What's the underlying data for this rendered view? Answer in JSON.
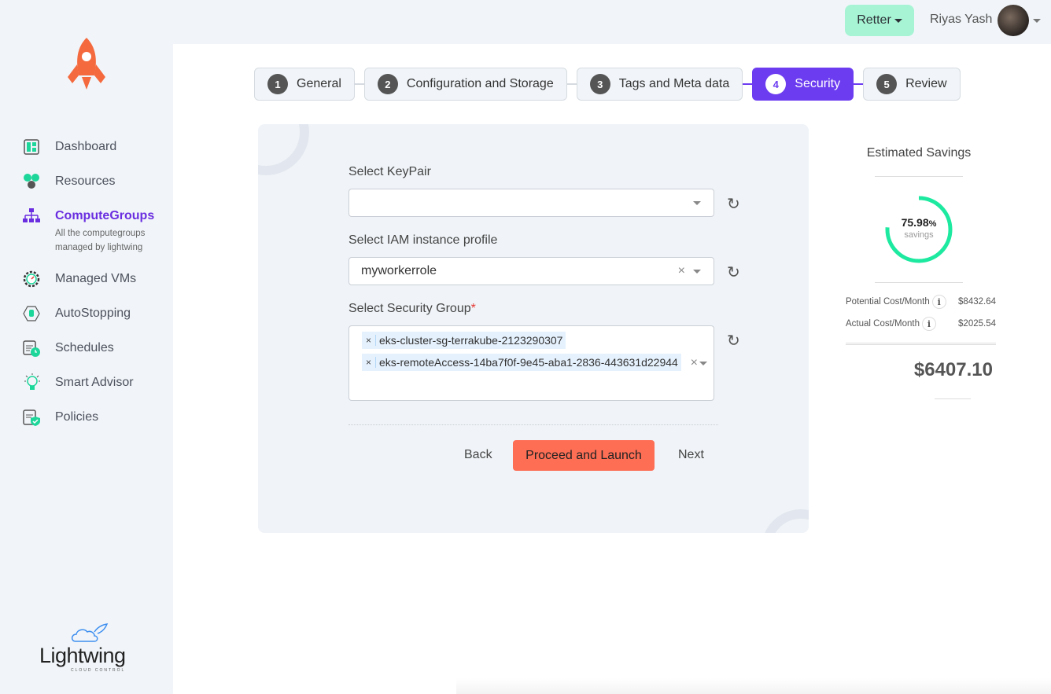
{
  "header": {
    "org_button": "Retter",
    "user_name": "Riyas Yash"
  },
  "sidebar": {
    "items": [
      {
        "label": "Dashboard",
        "icon": "dashboard-icon"
      },
      {
        "label": "Resources",
        "icon": "resources-icon"
      },
      {
        "label": "ComputeGroups",
        "icon": "network-icon",
        "subtitle": "All the computegroups managed by lightwing",
        "active": true
      },
      {
        "label": "Managed VMs",
        "icon": "gear-gauge-icon"
      },
      {
        "label": "AutoStopping",
        "icon": "hand-stop-icon"
      },
      {
        "label": "Schedules",
        "icon": "calendar-clock-icon"
      },
      {
        "label": "Smart Advisor",
        "icon": "lightbulb-icon"
      },
      {
        "label": "Policies",
        "icon": "clipboard-shield-icon"
      }
    ],
    "brand": "Lightwing",
    "brand_tagline": "CLOUD CONTROL"
  },
  "steps": [
    {
      "num": "1",
      "label": "General"
    },
    {
      "num": "2",
      "label": "Configuration and Storage"
    },
    {
      "num": "3",
      "label": "Tags and Meta data"
    },
    {
      "num": "4",
      "label": "Security",
      "active": true
    },
    {
      "num": "5",
      "label": "Review"
    }
  ],
  "form": {
    "keypair_label": "Select KeyPair",
    "keypair_value": "",
    "iam_label": "Select IAM instance profile",
    "iam_value": "myworkerrole",
    "sg_label": "Select Security Group",
    "sg_required": "*",
    "sg_values": [
      "eks-cluster-sg-terrakube-2123290307",
      "eks-remoteAccess-14ba7f0f-9e45-aba1-2836-443631d22944"
    ],
    "back": "Back",
    "proceed": "Proceed and Launch",
    "next": "Next"
  },
  "savings": {
    "title": "Estimated Savings",
    "percent": "75.98",
    "percent_sign": "%",
    "percent_value": 75.98,
    "savings_label": "savings",
    "potential_label": "Potential Cost/Month",
    "potential_value": "$8432.64",
    "actual_label": "Actual Cost/Month",
    "actual_value": "$2025.54",
    "total": "$6407.10",
    "ring_color": "#1de9a0"
  },
  "colors": {
    "accent": "#6c3cf0",
    "primary_button": "#fd6e55",
    "org_button": "#a6f4d4"
  }
}
